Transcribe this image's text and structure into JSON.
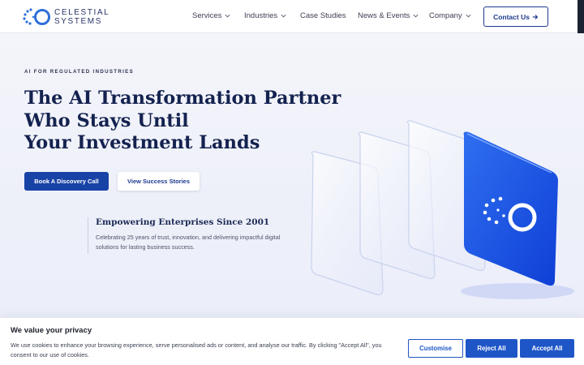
{
  "brand": {
    "name_line1": "CELESTIAL",
    "name_line2": "SYSTEMS",
    "logo_icon": "celestial-ring-logo"
  },
  "nav": {
    "items": [
      {
        "label": "Services",
        "has_dropdown": true
      },
      {
        "label": "Industries",
        "has_dropdown": true
      },
      {
        "label": "Case Studies",
        "has_dropdown": false
      },
      {
        "label": "News & Events",
        "has_dropdown": true
      },
      {
        "label": "Company",
        "has_dropdown": true
      }
    ],
    "contact_label": "Contact Us",
    "contact_icon": "arrow-right-icon"
  },
  "hero": {
    "eyebrow": "AI FOR REGULATED INDUSTRIES",
    "headline_lines": [
      "The AI Transformation Partner",
      "Who Stays Until",
      "Your Investment Lands"
    ],
    "primary_cta": "Book A Discovery Call",
    "secondary_cta": "View Success Stories",
    "tagline_title": "Empowering Enterprises Since 2001",
    "tagline_body": "Celebrating 25 years of trust, innovation, and delivering impactful digital solutions for lasting business success."
  },
  "cookie_banner": {
    "title": "We value your privacy",
    "text": "We use cookies to enhance your browsing experience, serve personalised ads or content, and analyse our traffic. By clicking \"Accept All\", you consent to our use of cookies.",
    "customise_label": "Customise",
    "reject_label": "Reject All",
    "accept_label": "Accept All"
  },
  "colors": {
    "primary": "#1843a6",
    "cookie_button": "#1f56c7",
    "navy_text": "#14224f",
    "hero_background": "#eef0f9"
  }
}
